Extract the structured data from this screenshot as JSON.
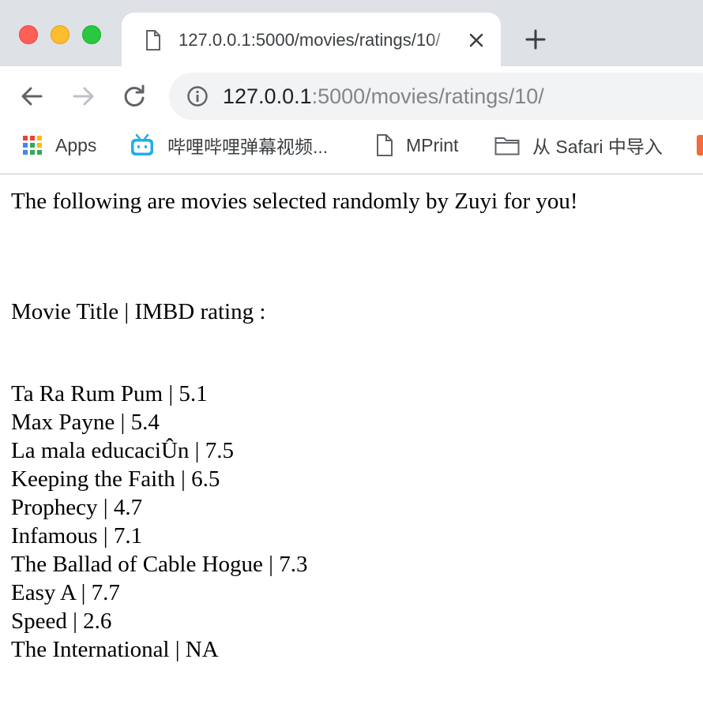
{
  "browser": {
    "tab": {
      "title": "127.0.0.1:5000/movies/ratings/10/"
    },
    "address_bar": {
      "host": "127.0.0.1",
      "path": ":5000/movies/ratings/10/"
    },
    "bookmarks": [
      {
        "label": "Apps",
        "icon": "apps-grid-icon"
      },
      {
        "label": "哔哩哔哩弹幕视频...",
        "icon": "bilibili-icon"
      },
      {
        "label": "MPrint",
        "icon": "page-icon"
      },
      {
        "label": "从 Safari 中导入",
        "icon": "folder-icon"
      }
    ]
  },
  "page": {
    "intro": "The following are movies selected randomly by Zuyi for you!",
    "header": "Movie Title | IMBD rating :",
    "movies": [
      "Ta Ra Rum Pum | 5.1",
      "Max Payne | 5.4",
      "La mala educaciÛn | 7.5",
      "Keeping the Faith | 6.5",
      "Prophecy | 4.7",
      "Infamous | 7.1",
      "The Ballad of Cable Hogue | 7.3",
      "Easy A | 7.7",
      "Speed | 2.6",
      "The International | NA"
    ]
  }
}
